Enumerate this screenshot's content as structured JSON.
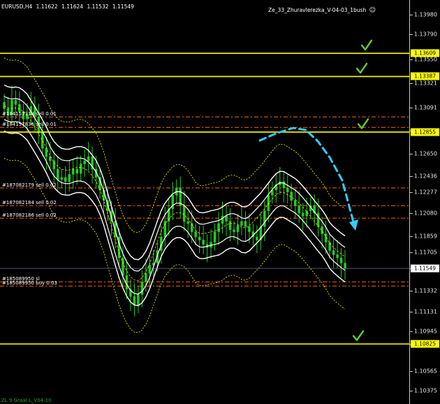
{
  "chart_header": {
    "symbol": "EURUSD,H4",
    "open": "1.11622",
    "high": "1.11624",
    "low": "1.11532",
    "close": "1.11549"
  },
  "expert_advisor": {
    "name": "Ze_33_Zhuravlerezka_V-04-03_1bush",
    "status_icon": "smiley-face-icon"
  },
  "indicator_label": "ZL 9 Graal-L_V04-10",
  "price_axis": {
    "ticks": [
      "1.13980",
      "1.13790",
      "1.13550",
      "1.13321",
      "1.13091",
      "1.12865",
      "1.12650",
      "1.12436",
      "1.12277",
      "1.12080",
      "1.11859",
      "1.11705",
      "1.11549",
      "1.11332",
      "1.11131",
      "1.10945",
      "1.10825",
      "1.10565",
      "1.10375"
    ],
    "tick_values": [
      1.1398,
      1.1379,
      1.1355,
      1.13321,
      1.13091,
      1.12865,
      1.1265,
      1.12436,
      1.12277,
      1.1208,
      1.11859,
      1.11705,
      1.11549,
      1.11332,
      1.11131,
      1.10945,
      1.10825,
      1.10565,
      1.10375
    ],
    "current_price": "1.11549",
    "levels": [
      "1.13609",
      "1.13387",
      "1.12855",
      "1.10825"
    ]
  },
  "orders": [
    {
      "label": "#184157318 sell 0.01",
      "price": 1.13
    },
    {
      "label": "#184157836 sell 0.01",
      "price": 1.129
    },
    {
      "label": "#187082179 sell 0.02",
      "price": 1.1232
    },
    {
      "label": "#187082184 sell 0.02",
      "price": 1.1215
    },
    {
      "label": "#187082186 sell 0.02",
      "price": 1.1203
    },
    {
      "label": "#185089950 sl",
      "price": 1.1142
    },
    {
      "label": "#185089950 buy 0.03",
      "price": 1.1138
    }
  ],
  "colors": {
    "level_line": "#ffff00",
    "check": "#66cc33",
    "arrow": "#33ccff",
    "candle": "#22cc22",
    "band": "#ffffff",
    "order_line": "#ff6600",
    "ma_dotted": "#ffff00"
  },
  "chart_data": {
    "type": "candlestick",
    "symbol": "EURUSD",
    "timeframe": "H4",
    "ylim": [
      1.1025,
      1.1412
    ],
    "closes": [
      1.1308,
      1.1302,
      1.1316,
      1.1312,
      1.1305,
      1.1298,
      1.1302,
      1.131,
      1.13,
      1.1285,
      1.127,
      1.1262,
      1.1258,
      1.125,
      1.124,
      1.1242,
      1.1238,
      1.1245,
      1.125,
      1.1246,
      1.1255,
      1.1258,
      1.1262,
      1.125,
      1.1242,
      1.123,
      1.122,
      1.121,
      1.12,
      1.1185,
      1.1165,
      1.1148,
      1.1135,
      1.1128,
      1.112,
      1.113,
      1.1142,
      1.115,
      1.1158,
      1.116,
      1.1172,
      1.1185,
      1.12,
      1.1212,
      1.1225,
      1.1232,
      1.1215,
      1.12,
      1.1198,
      1.119,
      1.1185,
      1.1182,
      1.1178,
      1.1175,
      1.118,
      1.119,
      1.1198,
      1.1205,
      1.12,
      1.1192,
      1.119,
      1.1196,
      1.12,
      1.1195,
      1.119,
      1.1185,
      1.1182,
      1.1195,
      1.121,
      1.1225,
      1.123,
      1.1235,
      1.1238,
      1.1232,
      1.1228,
      1.122,
      1.1215,
      1.1208,
      1.1205,
      1.121,
      1.1215,
      1.1208,
      1.1195,
      1.1188,
      1.118,
      1.1172,
      1.1168,
      1.1165,
      1.116,
      1.1155
    ],
    "horizontal_levels": [
      1.13609,
      1.13387,
      1.12855,
      1.10825
    ]
  }
}
